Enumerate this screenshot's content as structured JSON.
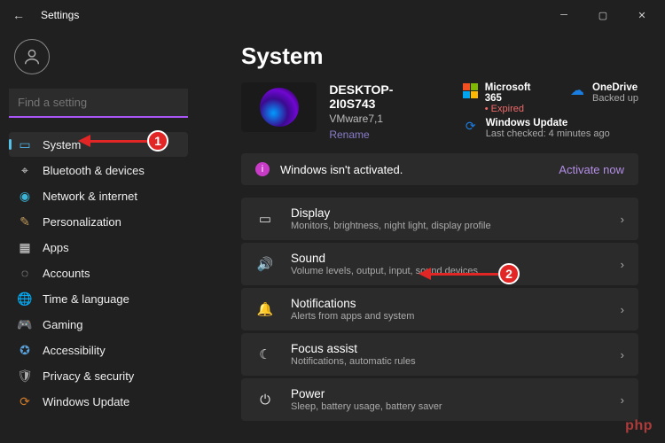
{
  "titlebar": {
    "title": "Settings"
  },
  "search": {
    "placeholder": "Find a setting"
  },
  "sidebar": {
    "items": [
      {
        "label": "System"
      },
      {
        "label": "Bluetooth & devices"
      },
      {
        "label": "Network & internet"
      },
      {
        "label": "Personalization"
      },
      {
        "label": "Apps"
      },
      {
        "label": "Accounts"
      },
      {
        "label": "Time & language"
      },
      {
        "label": "Gaming"
      },
      {
        "label": "Accessibility"
      },
      {
        "label": "Privacy & security"
      },
      {
        "label": "Windows Update"
      }
    ]
  },
  "main": {
    "page_title": "System",
    "device": {
      "name": "DESKTOP-2I0S743",
      "model": "VMware7,1",
      "rename": "Rename"
    },
    "status": {
      "m365": {
        "title": "Microsoft 365",
        "sub": "Expired"
      },
      "onedrive": {
        "title": "OneDrive",
        "sub": "Backed up"
      },
      "update": {
        "title": "Windows Update",
        "sub": "Last checked: 4 minutes ago"
      }
    },
    "banner": {
      "text": "Windows isn't activated.",
      "action": "Activate now"
    },
    "rows": [
      {
        "title": "Display",
        "desc": "Monitors, brightness, night light, display profile"
      },
      {
        "title": "Sound",
        "desc": "Volume levels, output, input, sound devices"
      },
      {
        "title": "Notifications",
        "desc": "Alerts from apps and system"
      },
      {
        "title": "Focus assist",
        "desc": "Notifications, automatic rules"
      },
      {
        "title": "Power",
        "desc": "Sleep, battery usage, battery saver"
      }
    ]
  },
  "annotations": {
    "marker1": "1",
    "marker2": "2"
  },
  "watermark": "php"
}
